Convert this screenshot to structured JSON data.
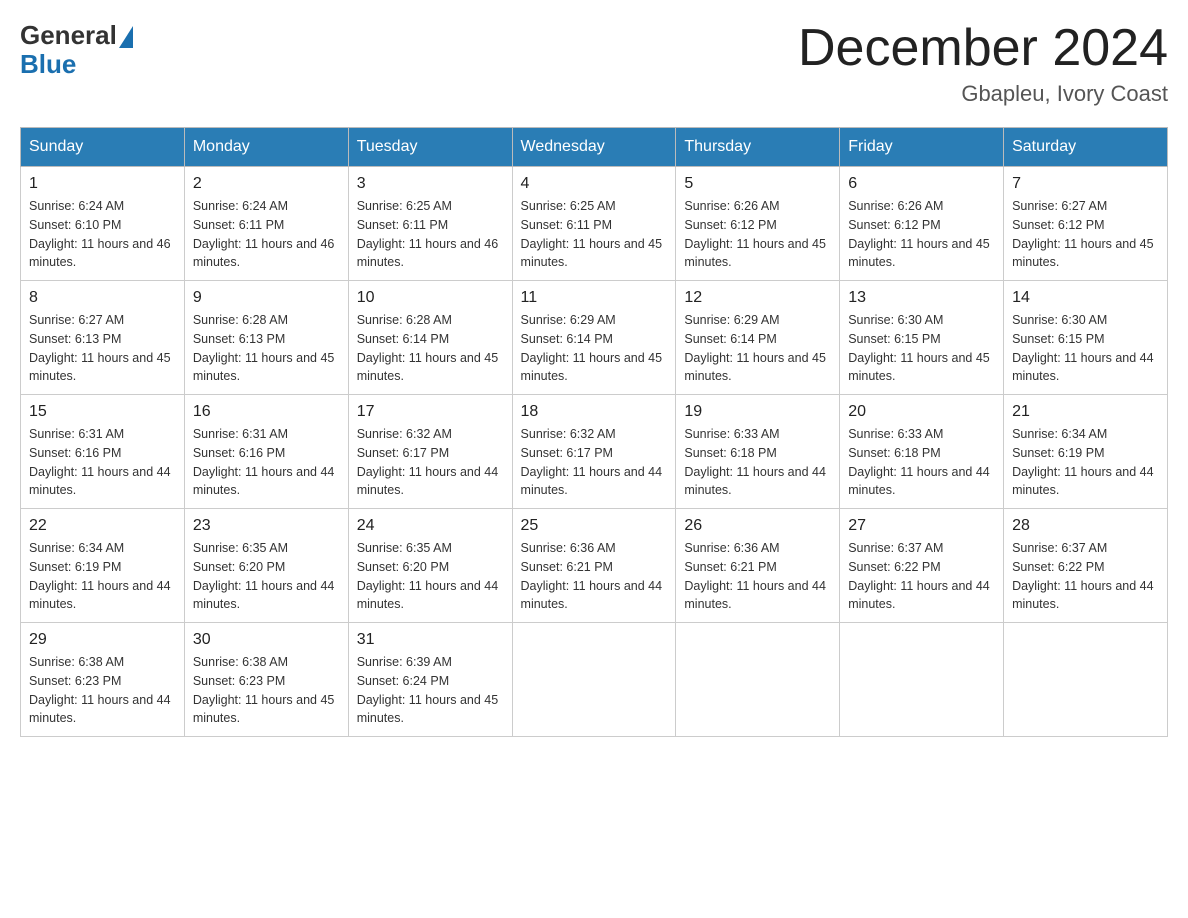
{
  "logo": {
    "text_general": "General",
    "text_blue": "Blue"
  },
  "header": {
    "title": "December 2024",
    "subtitle": "Gbapleu, Ivory Coast"
  },
  "days_of_week": [
    "Sunday",
    "Monday",
    "Tuesday",
    "Wednesday",
    "Thursday",
    "Friday",
    "Saturday"
  ],
  "weeks": [
    [
      {
        "day": "1",
        "sunrise": "6:24 AM",
        "sunset": "6:10 PM",
        "daylight": "11 hours and 46 minutes."
      },
      {
        "day": "2",
        "sunrise": "6:24 AM",
        "sunset": "6:11 PM",
        "daylight": "11 hours and 46 minutes."
      },
      {
        "day": "3",
        "sunrise": "6:25 AM",
        "sunset": "6:11 PM",
        "daylight": "11 hours and 46 minutes."
      },
      {
        "day": "4",
        "sunrise": "6:25 AM",
        "sunset": "6:11 PM",
        "daylight": "11 hours and 45 minutes."
      },
      {
        "day": "5",
        "sunrise": "6:26 AM",
        "sunset": "6:12 PM",
        "daylight": "11 hours and 45 minutes."
      },
      {
        "day": "6",
        "sunrise": "6:26 AM",
        "sunset": "6:12 PM",
        "daylight": "11 hours and 45 minutes."
      },
      {
        "day": "7",
        "sunrise": "6:27 AM",
        "sunset": "6:12 PM",
        "daylight": "11 hours and 45 minutes."
      }
    ],
    [
      {
        "day": "8",
        "sunrise": "6:27 AM",
        "sunset": "6:13 PM",
        "daylight": "11 hours and 45 minutes."
      },
      {
        "day": "9",
        "sunrise": "6:28 AM",
        "sunset": "6:13 PM",
        "daylight": "11 hours and 45 minutes."
      },
      {
        "day": "10",
        "sunrise": "6:28 AM",
        "sunset": "6:14 PM",
        "daylight": "11 hours and 45 minutes."
      },
      {
        "day": "11",
        "sunrise": "6:29 AM",
        "sunset": "6:14 PM",
        "daylight": "11 hours and 45 minutes."
      },
      {
        "day": "12",
        "sunrise": "6:29 AM",
        "sunset": "6:14 PM",
        "daylight": "11 hours and 45 minutes."
      },
      {
        "day": "13",
        "sunrise": "6:30 AM",
        "sunset": "6:15 PM",
        "daylight": "11 hours and 45 minutes."
      },
      {
        "day": "14",
        "sunrise": "6:30 AM",
        "sunset": "6:15 PM",
        "daylight": "11 hours and 44 minutes."
      }
    ],
    [
      {
        "day": "15",
        "sunrise": "6:31 AM",
        "sunset": "6:16 PM",
        "daylight": "11 hours and 44 minutes."
      },
      {
        "day": "16",
        "sunrise": "6:31 AM",
        "sunset": "6:16 PM",
        "daylight": "11 hours and 44 minutes."
      },
      {
        "day": "17",
        "sunrise": "6:32 AM",
        "sunset": "6:17 PM",
        "daylight": "11 hours and 44 minutes."
      },
      {
        "day": "18",
        "sunrise": "6:32 AM",
        "sunset": "6:17 PM",
        "daylight": "11 hours and 44 minutes."
      },
      {
        "day": "19",
        "sunrise": "6:33 AM",
        "sunset": "6:18 PM",
        "daylight": "11 hours and 44 minutes."
      },
      {
        "day": "20",
        "sunrise": "6:33 AM",
        "sunset": "6:18 PM",
        "daylight": "11 hours and 44 minutes."
      },
      {
        "day": "21",
        "sunrise": "6:34 AM",
        "sunset": "6:19 PM",
        "daylight": "11 hours and 44 minutes."
      }
    ],
    [
      {
        "day": "22",
        "sunrise": "6:34 AM",
        "sunset": "6:19 PM",
        "daylight": "11 hours and 44 minutes."
      },
      {
        "day": "23",
        "sunrise": "6:35 AM",
        "sunset": "6:20 PM",
        "daylight": "11 hours and 44 minutes."
      },
      {
        "day": "24",
        "sunrise": "6:35 AM",
        "sunset": "6:20 PM",
        "daylight": "11 hours and 44 minutes."
      },
      {
        "day": "25",
        "sunrise": "6:36 AM",
        "sunset": "6:21 PM",
        "daylight": "11 hours and 44 minutes."
      },
      {
        "day": "26",
        "sunrise": "6:36 AM",
        "sunset": "6:21 PM",
        "daylight": "11 hours and 44 minutes."
      },
      {
        "day": "27",
        "sunrise": "6:37 AM",
        "sunset": "6:22 PM",
        "daylight": "11 hours and 44 minutes."
      },
      {
        "day": "28",
        "sunrise": "6:37 AM",
        "sunset": "6:22 PM",
        "daylight": "11 hours and 44 minutes."
      }
    ],
    [
      {
        "day": "29",
        "sunrise": "6:38 AM",
        "sunset": "6:23 PM",
        "daylight": "11 hours and 44 minutes."
      },
      {
        "day": "30",
        "sunrise": "6:38 AM",
        "sunset": "6:23 PM",
        "daylight": "11 hours and 45 minutes."
      },
      {
        "day": "31",
        "sunrise": "6:39 AM",
        "sunset": "6:24 PM",
        "daylight": "11 hours and 45 minutes."
      },
      null,
      null,
      null,
      null
    ]
  ]
}
